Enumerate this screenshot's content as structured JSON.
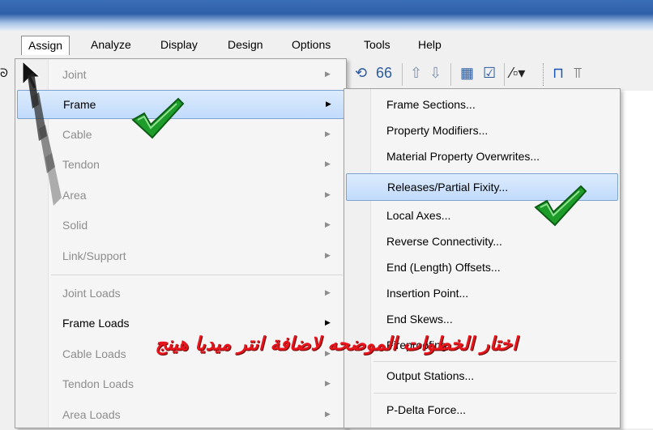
{
  "menubar": {
    "items": [
      "Assign",
      "Analyze",
      "Display",
      "Design",
      "Options",
      "Tools",
      "Help"
    ],
    "active": "Assign"
  },
  "assign_menu": {
    "items": [
      {
        "label": "Joint",
        "enabled": false,
        "submenu": true
      },
      {
        "label": "Frame",
        "enabled": true,
        "submenu": true,
        "highlighted": true
      },
      {
        "label": "Cable",
        "enabled": false,
        "submenu": true
      },
      {
        "label": "Tendon",
        "enabled": false,
        "submenu": true
      },
      {
        "label": "Area",
        "enabled": false,
        "submenu": true
      },
      {
        "label": "Solid",
        "enabled": false,
        "submenu": true
      },
      {
        "label": "Link/Support",
        "enabled": false,
        "submenu": true
      },
      {
        "label": "Joint Loads",
        "enabled": false,
        "submenu": true
      },
      {
        "label": "Frame Loads",
        "enabled": true,
        "submenu": true
      },
      {
        "label": "Cable Loads",
        "enabled": false,
        "submenu": true
      },
      {
        "label": "Tendon Loads",
        "enabled": false,
        "submenu": true
      },
      {
        "label": "Area Loads",
        "enabled": false,
        "submenu": true
      }
    ]
  },
  "frame_submenu": {
    "items": [
      {
        "label": "Frame Sections..."
      },
      {
        "label": "Property Modifiers..."
      },
      {
        "label": "Material Property Overwrites..."
      },
      {
        "label": "Releases/Partial Fixity...",
        "highlighted": true
      },
      {
        "label": "Local Axes..."
      },
      {
        "label": "Reverse Connectivity..."
      },
      {
        "label": "End (Length) Offsets..."
      },
      {
        "label": "Insertion Point..."
      },
      {
        "label": "End Skews..."
      },
      {
        "label": "Fireproofing..."
      },
      {
        "label": "Output Stations..."
      },
      {
        "label": "P-Delta Force..."
      }
    ]
  },
  "toolbar": {
    "icons": [
      "rotate-3d-icon",
      "glasses-view-icon",
      "arrow-up-icon",
      "arrow-down-icon",
      "grid-snap-icon",
      "checkbox-icon",
      "fraction-icon",
      "frame-draw-icon",
      "column-draw-icon"
    ]
  },
  "annotation": {
    "text": "اختار الخطوات الموضحه لاضافة انتر ميديا هينج",
    "color": "#e8141c"
  },
  "checkmark_color": "#1e9c2a"
}
